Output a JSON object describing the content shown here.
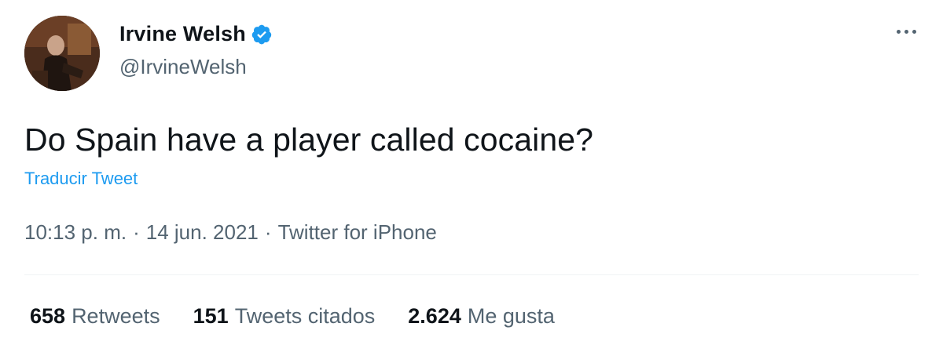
{
  "author": {
    "display_name": "Irvine Welsh",
    "handle": "@IrvineWelsh",
    "verified": true,
    "verified_color": "#1d9bf0",
    "avatar_icon": "profile-photo"
  },
  "more_icon": "ellipsis-icon",
  "tweet": {
    "text": "Do Spain have a player called cocaine?",
    "translate_label": "Traducir Tweet"
  },
  "meta": {
    "time": "10:13 p. m.",
    "separator": "·",
    "date": "14 jun. 2021",
    "source": "Twitter for iPhone"
  },
  "stats": [
    {
      "count": "658",
      "label": "Retweets"
    },
    {
      "count": "151",
      "label": "Tweets citados"
    },
    {
      "count": "2.624",
      "label": "Me gusta"
    }
  ],
  "colors": {
    "accent": "#1d9bf0",
    "text_primary": "#0f1419",
    "text_secondary": "#536471"
  }
}
